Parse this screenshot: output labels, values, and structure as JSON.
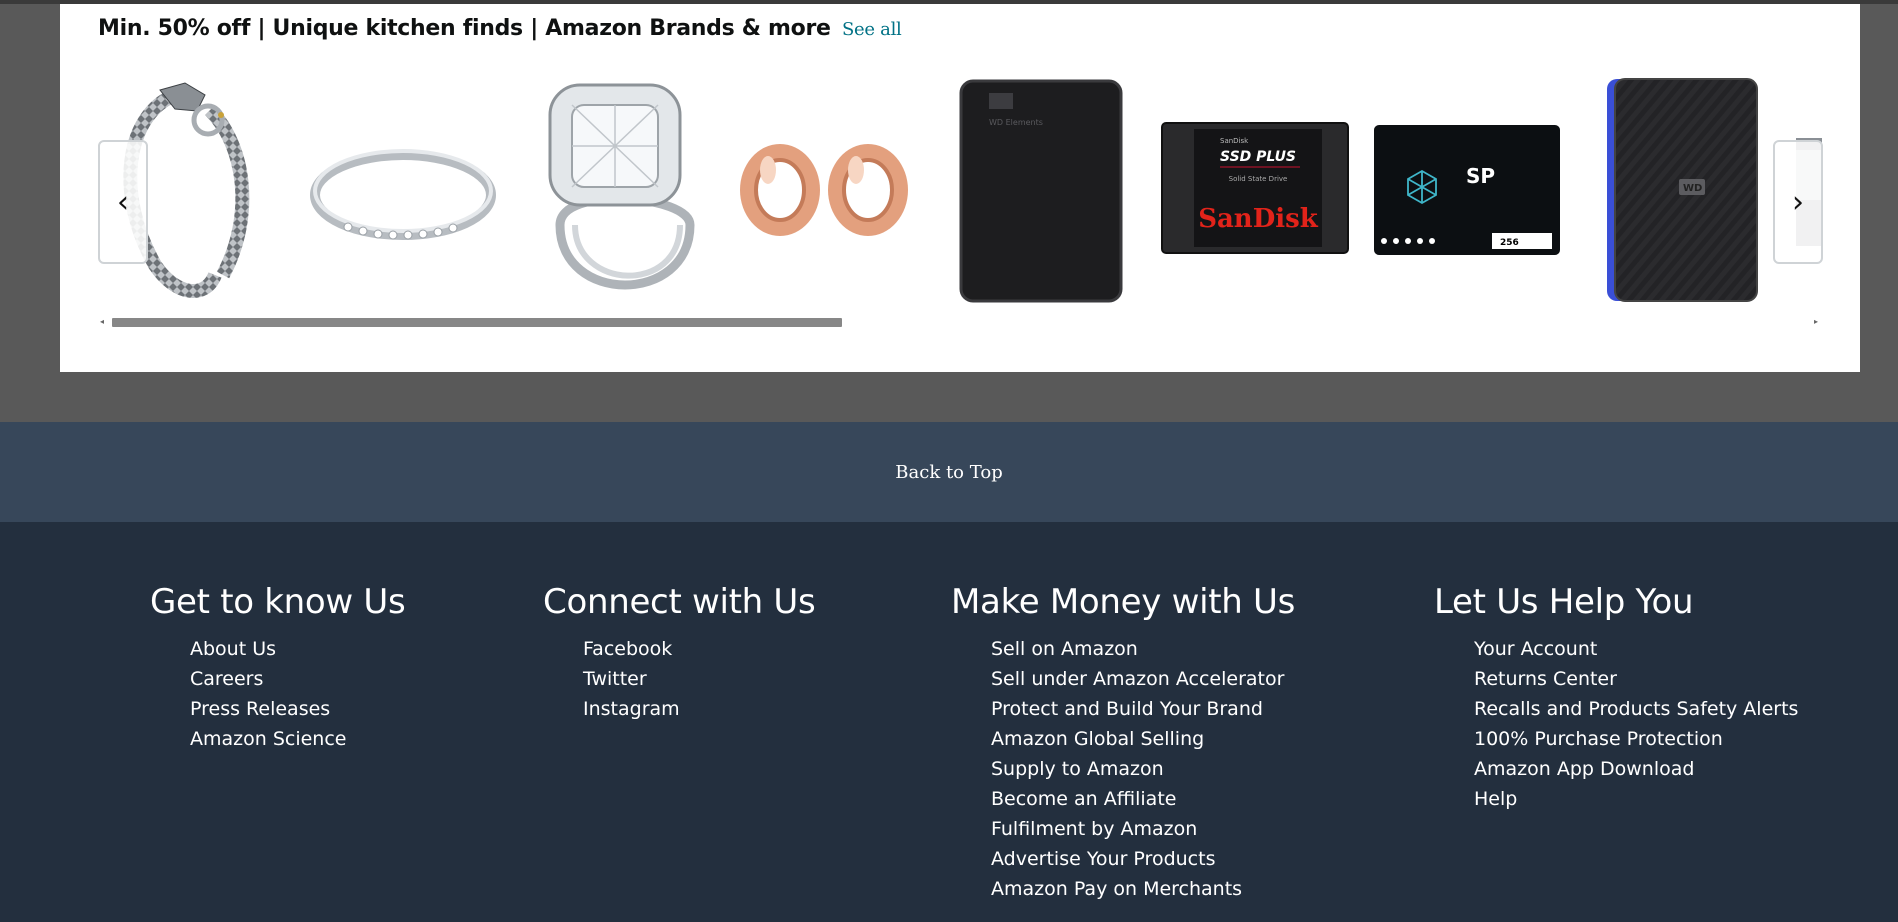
{
  "carousel": {
    "title": "Min. 50% off | Unique kitchen finds | Amazon Brands & more",
    "see_all": "See all",
    "prev_glyph": "‹",
    "next_glyph": "›",
    "products": [
      {
        "icon": "dragon-bracelet-image"
      },
      {
        "icon": "silver-ring-image"
      },
      {
        "icon": "diamond-ring-set-image"
      },
      {
        "icon": "rose-gold-ear-plugs-image"
      },
      {
        "icon": "wd-external-drive-image",
        "brand_text": "WD Elements"
      },
      {
        "icon": "sandisk-ssd-image",
        "brand_small": "SanDisk",
        "model": "SSD PLUS",
        "sub": "Solid State Drive",
        "brand": "SanDisk"
      },
      {
        "icon": "sp-ssd-image",
        "brand": "SP",
        "capacity": "256"
      },
      {
        "icon": "wd-blue-drive-image",
        "brand_text": "WD"
      },
      {
        "icon": "partial-product-image"
      }
    ],
    "scroll_progress": 0.43
  },
  "back_to_top": "Back to Top",
  "footer": {
    "columns": [
      {
        "heading": "Get to know Us",
        "links": [
          "About Us",
          "Careers",
          "Press Releases",
          "Amazon Science"
        ]
      },
      {
        "heading": "Connect with Us",
        "links": [
          "Facebook",
          "Twitter",
          "Instagram"
        ]
      },
      {
        "heading": "Make Money with Us",
        "links": [
          "Sell on Amazon",
          "Sell under Amazon Accelerator",
          "Protect and Build Your Brand",
          "Amazon Global Selling",
          "Supply to Amazon",
          "Become an Affiliate",
          "Fulfilment by Amazon",
          "Advertise Your Products",
          "Amazon Pay on Merchants"
        ]
      },
      {
        "heading": "Let Us Help You",
        "links": [
          "Your Account",
          "Returns Center",
          "Recalls and Products Safety Alerts",
          "100% Purchase Protection",
          "Amazon App Download",
          "Help"
        ]
      }
    ]
  },
  "colors": {
    "page_bg": "#595959",
    "back_to_top_bg": "#37475a",
    "footer_bg": "#232f3e",
    "link": "#007185"
  }
}
